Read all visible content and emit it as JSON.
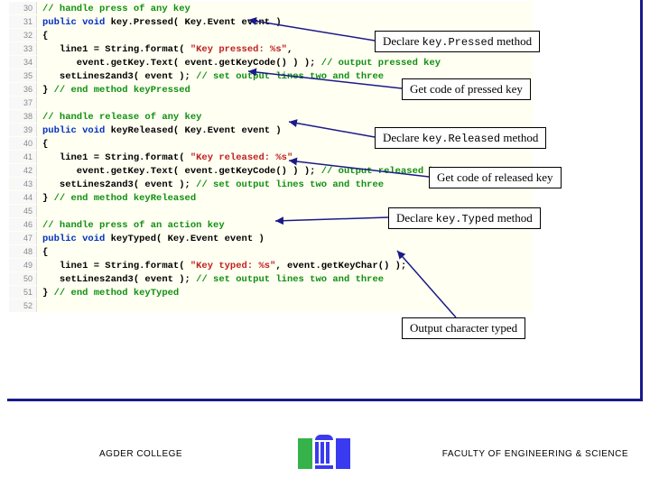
{
  "code": {
    "lines": [
      {
        "n": "30",
        "segs": [
          {
            "cls": "c-comment",
            "t": "// handle press of any key"
          }
        ]
      },
      {
        "n": "31",
        "segs": [
          {
            "cls": "c-kw",
            "t": "public void"
          },
          {
            "cls": "c-plain",
            "t": " key.Pressed( Key.Event event )"
          }
        ]
      },
      {
        "n": "32",
        "segs": [
          {
            "cls": "c-plain",
            "t": "{"
          }
        ]
      },
      {
        "n": "33",
        "segs": [
          {
            "cls": "c-plain",
            "t": "   line1 = String.format( "
          },
          {
            "cls": "c-str",
            "t": "\"Key pressed: %s\""
          },
          {
            "cls": "c-plain",
            "t": ","
          }
        ]
      },
      {
        "n": "34",
        "segs": [
          {
            "cls": "c-plain",
            "t": "      event.getKey.Text( event.getKeyCode() ) ); "
          },
          {
            "cls": "c-comment",
            "t": "// output pressed key"
          }
        ]
      },
      {
        "n": "35",
        "segs": [
          {
            "cls": "c-plain",
            "t": "   setLines2and3( event ); "
          },
          {
            "cls": "c-comment",
            "t": "// set output lines two and three"
          }
        ]
      },
      {
        "n": "36",
        "segs": [
          {
            "cls": "c-plain",
            "t": "} "
          },
          {
            "cls": "c-comment",
            "t": "// end method keyPressed"
          }
        ]
      },
      {
        "n": "37",
        "segs": [
          {
            "cls": "c-plain",
            "t": ""
          }
        ]
      },
      {
        "n": "38",
        "segs": [
          {
            "cls": "c-comment",
            "t": "// handle release of any key"
          }
        ]
      },
      {
        "n": "39",
        "segs": [
          {
            "cls": "c-kw",
            "t": "public void"
          },
          {
            "cls": "c-plain",
            "t": " keyReleased( Key.Event event )"
          }
        ]
      },
      {
        "n": "40",
        "segs": [
          {
            "cls": "c-plain",
            "t": "{"
          }
        ]
      },
      {
        "n": "41",
        "segs": [
          {
            "cls": "c-plain",
            "t": "   line1 = String.format( "
          },
          {
            "cls": "c-str",
            "t": "\"Key released: %s\""
          },
          {
            "cls": "c-plain",
            "t": ","
          }
        ]
      },
      {
        "n": "42",
        "segs": [
          {
            "cls": "c-plain",
            "t": "      event.getKey.Text( event.getKeyCode() ) ); "
          },
          {
            "cls": "c-comment",
            "t": "// output released key"
          }
        ]
      },
      {
        "n": "43",
        "segs": [
          {
            "cls": "c-plain",
            "t": "   setLines2and3( event ); "
          },
          {
            "cls": "c-comment",
            "t": "// set output lines two and three"
          }
        ]
      },
      {
        "n": "44",
        "segs": [
          {
            "cls": "c-plain",
            "t": "} "
          },
          {
            "cls": "c-comment",
            "t": "// end method keyReleased"
          }
        ]
      },
      {
        "n": "45",
        "segs": [
          {
            "cls": "c-plain",
            "t": ""
          }
        ]
      },
      {
        "n": "46",
        "segs": [
          {
            "cls": "c-comment",
            "t": "// handle press of an action key"
          }
        ]
      },
      {
        "n": "47",
        "segs": [
          {
            "cls": "c-kw",
            "t": "public void"
          },
          {
            "cls": "c-plain",
            "t": " keyTyped( Key.Event event )"
          }
        ]
      },
      {
        "n": "48",
        "segs": [
          {
            "cls": "c-plain",
            "t": "{"
          }
        ]
      },
      {
        "n": "49",
        "segs": [
          {
            "cls": "c-plain",
            "t": "   line1 = String.format( "
          },
          {
            "cls": "c-str",
            "t": "\"Key typed: %s\""
          },
          {
            "cls": "c-plain",
            "t": ", event.getKeyChar() );"
          }
        ]
      },
      {
        "n": "50",
        "segs": [
          {
            "cls": "c-plain",
            "t": "   setLines2and3( event ); "
          },
          {
            "cls": "c-comment",
            "t": "// set output lines two and three"
          }
        ]
      },
      {
        "n": "51",
        "segs": [
          {
            "cls": "c-plain",
            "t": "} "
          },
          {
            "cls": "c-comment",
            "t": "// end method keyTyped"
          }
        ]
      },
      {
        "n": "52",
        "segs": [
          {
            "cls": "c-plain",
            "t": ""
          }
        ]
      }
    ]
  },
  "callouts": {
    "c1a": "Declare ",
    "c1b": "key.Pressed",
    "c1c": " method",
    "c2": "Get code of pressed key",
    "c3a": "Declare ",
    "c3b": "key.Released",
    "c3c": " method",
    "c4": "Get code of released key",
    "c5a": "Declare ",
    "c5b": "key.Typed",
    "c5c": " method",
    "c6": "Output character typed"
  },
  "footer": {
    "left": "AGDER COLLEGE",
    "right": "FACULTY OF ENGINEERING & SCIENCE"
  }
}
